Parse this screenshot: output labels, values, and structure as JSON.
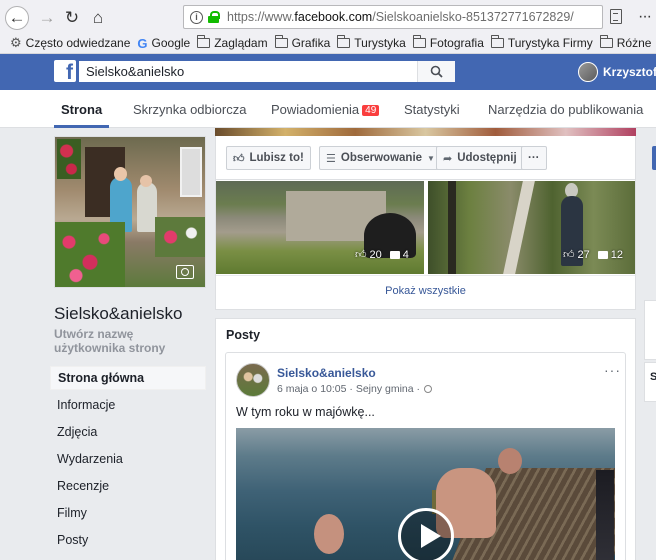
{
  "browser": {
    "url_prefix": "https://www.",
    "url_host": "facebook.com",
    "url_path": "/Sielskoanielsko-851372771672829/",
    "bookmarks": [
      "Często odwiedzane",
      "Google",
      "Zaglądam",
      "Grafika",
      "Turystyka",
      "Fotografia",
      "Turystyka Firmy",
      "Różne"
    ]
  },
  "fb": {
    "logo": "f",
    "search_value": "Sielsko&anielsko",
    "user_name": "Krzysztof"
  },
  "tabs": {
    "items": [
      "Strona",
      "Skrzynka odbiorcza",
      "Powiadomienia",
      "Statystyki",
      "Narzędzia do publikowania"
    ],
    "notifications_badge": "49"
  },
  "left": {
    "page_name": "Sielsko&anielsko",
    "username_prompt": "Utwórz nazwę użytkownika strony",
    "nav": [
      "Strona główna",
      "Informacje",
      "Zdjęcia",
      "Wydarzenia",
      "Recenzje",
      "Filmy",
      "Posty"
    ]
  },
  "actions": {
    "like": "Lubisz to!",
    "follow": "Obserwowanie",
    "share": "Udostępnij",
    "more": "···"
  },
  "photos": {
    "p1_likes": "20",
    "p1_comments": "4",
    "p2_likes": "27",
    "p2_comments": "12",
    "show_all": "Pokaż wszystkie"
  },
  "posts": {
    "title": "Posty",
    "author": "Sielsko&anielsko",
    "date": "6 maja o 10:05",
    "location": "Sejny gmina",
    "text": "W tym roku w majówkę...",
    "right_card_letter": "S"
  },
  "colors": {
    "fb_blue": "#4267b2",
    "link": "#385898",
    "badge": "#fa3e3e"
  }
}
